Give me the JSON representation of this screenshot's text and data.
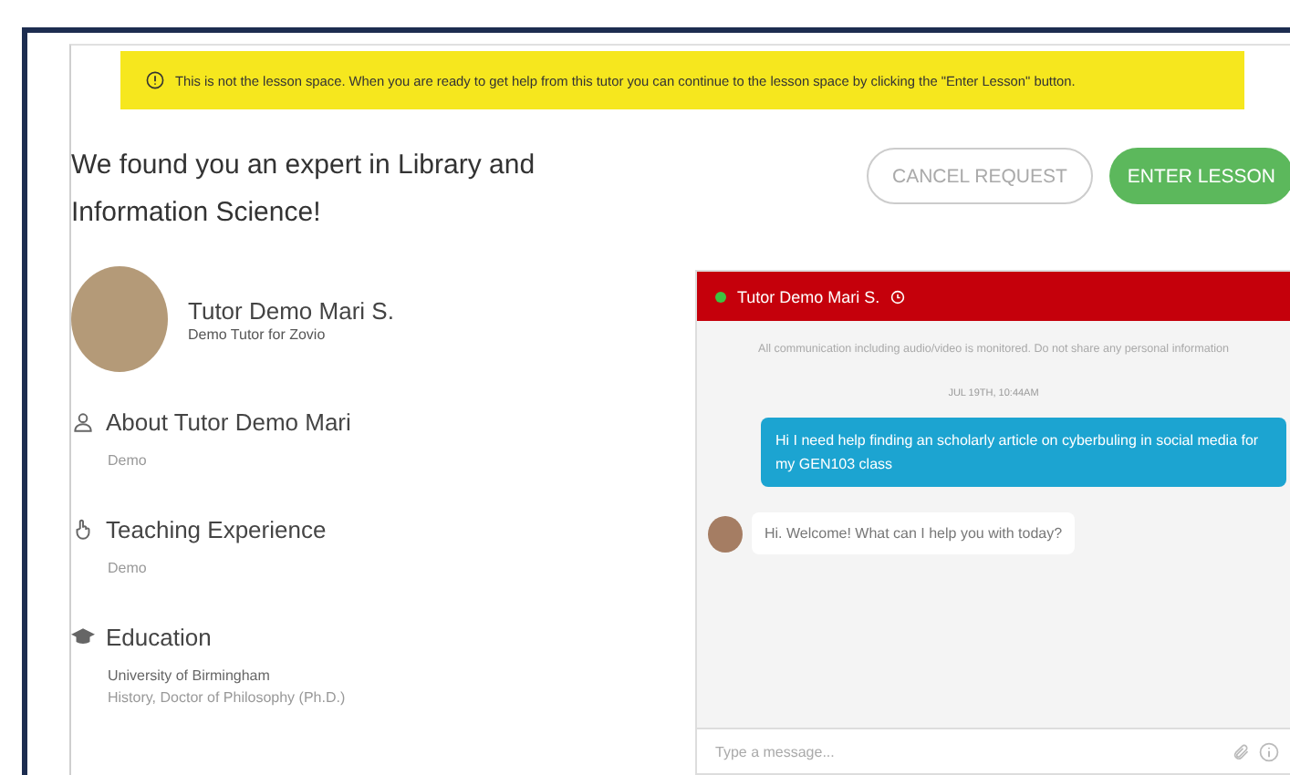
{
  "banner": {
    "text": "This is not the lesson space. When you are ready to get help from this tutor you can continue to the lesson space by clicking the \"Enter Lesson\" button."
  },
  "heading": "We found you an expert in Library and Information Science!",
  "buttons": [
    {
      "label": "CANCEL REQUEST",
      "kind": "outline"
    },
    {
      "label": "ENTER LESSON",
      "kind": "primary"
    }
  ],
  "tutor": {
    "name": "Tutor Demo Mari S.",
    "subtitle": "Demo Tutor for Zovio"
  },
  "sections": [
    {
      "kind": "about",
      "title": "About Tutor Demo Mari",
      "lines": [
        "Demo"
      ]
    },
    {
      "kind": "teaching",
      "title": "Teaching Experience",
      "lines": [
        "Demo"
      ]
    },
    {
      "kind": "education",
      "title": "Education",
      "lines": [
        "University of Birmingham",
        "History,  Doctor of Philosophy (Ph.D.)"
      ]
    }
  ],
  "chat": {
    "title": "Tutor Demo Mari S.",
    "online": true,
    "notice": "All communication including audio/video is monitored. Do not share any personal information",
    "date": "JUL 19TH, 10:44AM",
    "messages": [
      {
        "kind": "sent",
        "text": "Hi I need help finding an scholarly article on cyberbuling in social media for my GEN103 class"
      },
      {
        "kind": "received",
        "text": "Hi. Welcome! What can I help you with today?"
      }
    ],
    "input": {
      "placeholder": "Type a message..."
    }
  }
}
